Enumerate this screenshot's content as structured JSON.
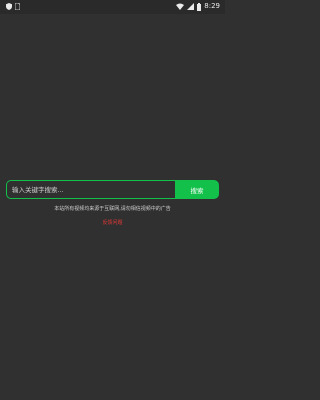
{
  "status_bar": {
    "time": "8:29",
    "icons": {
      "left": [
        "shield-icon",
        "sim-card-icon"
      ],
      "right": [
        "wifi-icon",
        "signal-icon",
        "battery-icon"
      ]
    }
  },
  "search": {
    "placeholder": "输入关键字搜索...",
    "button_label": "搜索",
    "accent_color": "#13c04a"
  },
  "notice": {
    "text": "本站所有视频均来源于互联网,请勿相信视频中的广告"
  },
  "feedback": {
    "label": "反馈问题",
    "color": "#e53935"
  },
  "colors": {
    "background": "#303030"
  }
}
